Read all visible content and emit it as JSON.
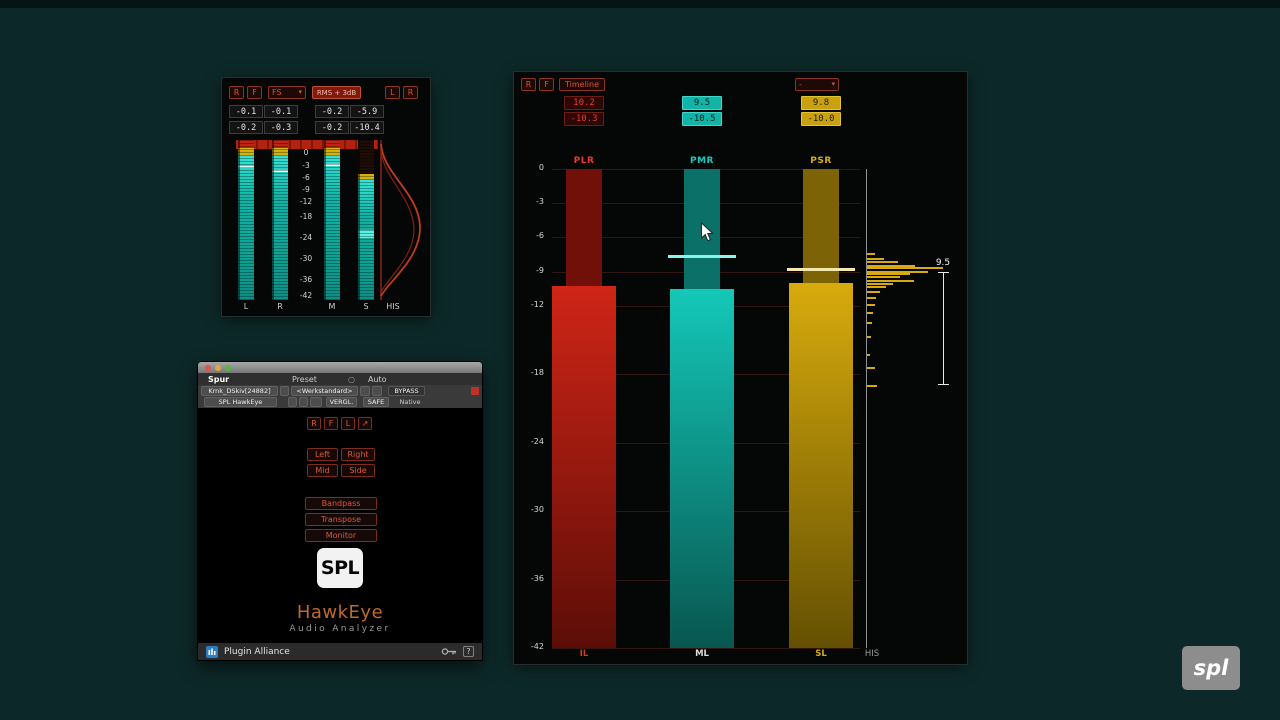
{
  "page": {
    "background_color": "#0d2828"
  },
  "icons": {
    "chevron_down": "▾",
    "route_arrow": "↗",
    "compare_circle": "○"
  },
  "mini_meter": {
    "buttons": {
      "reset": "R",
      "freeze": "F",
      "scale_mode": "FS",
      "meter_mode": "RMS + 3dB",
      "left": "L",
      "right": "R"
    },
    "readouts": {
      "row1": [
        "-0.1",
        "-0.1",
        "-0.2",
        "-5.9"
      ],
      "row2": [
        "-0.2",
        "-0.3",
        "-0.2",
        "-10.4"
      ]
    },
    "scale": [
      "0",
      "-3",
      "-6",
      "-9",
      "-12",
      "-18",
      "-24",
      "-30",
      "-36",
      "-42"
    ],
    "channel_labels": [
      "L",
      "R",
      "M",
      "S",
      "HIS"
    ]
  },
  "plugin_window": {
    "window_title": "Spur",
    "header": {
      "preset_label": "Preset",
      "auto_label": "Auto",
      "track_name": "Krnk_DSkiv[24882]",
      "preset_name": "<Werkstandard>",
      "bypass_label": "BYPASS",
      "plugin_name": "SPL HawkEye",
      "compare_label": "VERGL.",
      "safe_label": "SAFE",
      "format_label": "Native"
    },
    "controls": {
      "reset": "R",
      "freeze": "F",
      "link": "L",
      "left": "Left",
      "right": "Right",
      "mid": "Mid",
      "side": "Side",
      "bandpass": "Bandpass",
      "transpose": "Transpose",
      "monitor": "Monitor"
    },
    "logo_text": "SPL",
    "product_name": "HawkEye",
    "product_subtitle": "Audio Analyzer",
    "footer": {
      "brand": "Plugin Alliance",
      "help": "?"
    }
  },
  "main_meter": {
    "buttons": {
      "reset": "R",
      "freeze": "F",
      "timeline": "Timeline",
      "range_select": "-"
    },
    "scale": [
      "0",
      "-3",
      "-6",
      "-9",
      "-12",
      "-18",
      "-24",
      "-30",
      "-36",
      "-42"
    ],
    "columns": [
      {
        "label": "PLR",
        "value_top": "10.2",
        "value_bottom": "-10.3",
        "bottom_label": "IL",
        "bar_db": -10.3,
        "marker_db": null,
        "color_narrow": "#701009",
        "color_bright": "#d02517",
        "color_dark": "#5c0d07",
        "marker_color": "#ff5a48",
        "label_color": "#e8392b",
        "bottom_label_color": "#d83a28",
        "box_bg": "#2b0805",
        "box_text": "#ef3b2a",
        "box_border": "#6f1d12"
      },
      {
        "label": "PMR",
        "value_top": "9.5",
        "value_bottom": "-10.5",
        "bottom_label": "ML",
        "bar_db": -10.5,
        "marker_db": -7.7,
        "color_narrow": "#0b7168",
        "color_bright": "#14c8b9",
        "color_dark": "#085750",
        "marker_color": "#86f6ea",
        "label_color": "#16cabb",
        "bottom_label_color": "#dcdcdc",
        "box_bg": "#11b4a6",
        "box_text": "#03221f",
        "box_border": "#3bd9cb"
      },
      {
        "label": "PSR",
        "value_top": "9.8",
        "value_bottom": "-10.0",
        "bottom_label": "SL",
        "bar_db": -10.0,
        "marker_db": -8.8,
        "color_narrow": "#7c6305",
        "color_bright": "#d8ab0d",
        "color_dark": "#645002",
        "marker_color": "#f4e8ae",
        "label_color": "#d8ab12",
        "bottom_label_color": "#d8ab12",
        "box_bg": "#c9a110",
        "box_text": "#241c02",
        "box_border": "#e3c233"
      }
    ],
    "histogram_label": "HIS",
    "histogram": {
      "marker_value": "9.5",
      "color": "#d9aa10",
      "spikes": [
        [
          -7.4,
          0.1
        ],
        [
          -7.8,
          0.22
        ],
        [
          -8.1,
          0.4
        ],
        [
          -8.4,
          0.62
        ],
        [
          -8.6,
          0.97
        ],
        [
          -8.9,
          0.78
        ],
        [
          -9.1,
          0.55
        ],
        [
          -9.4,
          0.42
        ],
        [
          -9.7,
          0.6
        ],
        [
          -10.0,
          0.33
        ],
        [
          -10.3,
          0.24
        ],
        [
          -10.7,
          0.17
        ],
        [
          -11.2,
          0.12
        ],
        [
          -11.8,
          0.1
        ],
        [
          -12.5,
          0.08
        ],
        [
          -13.4,
          0.06
        ],
        [
          -14.6,
          0.05
        ],
        [
          -16.2,
          0.04
        ],
        [
          -17.4,
          0.1
        ],
        [
          -18.9,
          0.13
        ]
      ]
    }
  },
  "watermark": "spl"
}
